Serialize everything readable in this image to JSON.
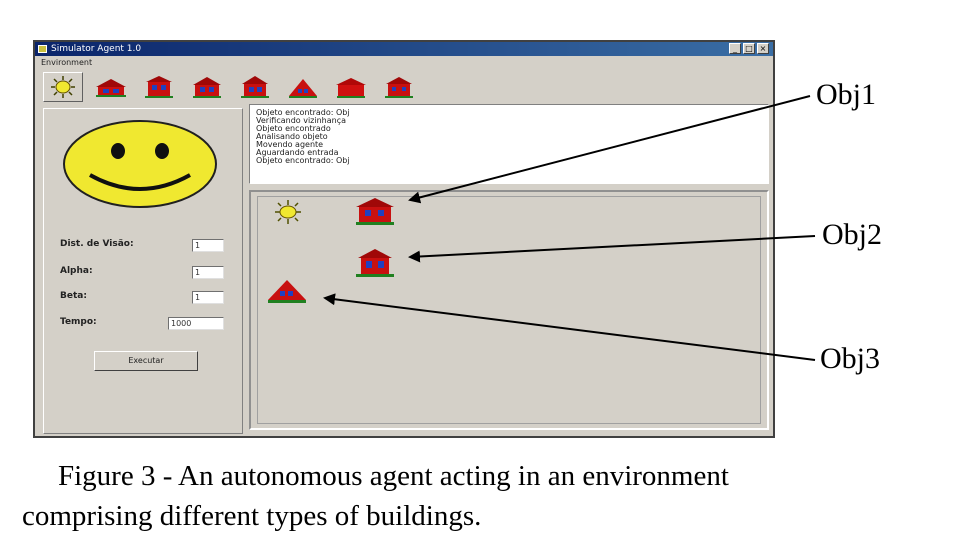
{
  "window": {
    "title": "Simulator Agent 1.0",
    "menu": "Environment",
    "buttons": [
      "_",
      "□",
      "×"
    ]
  },
  "toolbar": {
    "items": [
      {
        "name": "agent",
        "icon": "sun-agent-icon"
      },
      {
        "name": "building1",
        "icon": "building-icon"
      },
      {
        "name": "building2",
        "icon": "building-icon"
      },
      {
        "name": "building3",
        "icon": "building-icon"
      },
      {
        "name": "building4",
        "icon": "building-icon"
      },
      {
        "name": "building5",
        "icon": "building-icon"
      },
      {
        "name": "building6",
        "icon": "building-icon"
      },
      {
        "name": "building7",
        "icon": "building-icon"
      }
    ]
  },
  "params": {
    "vision_label": "Dist. de Visão:",
    "vision_value": "1",
    "alpha_label": "Alpha:",
    "alpha_value": "1",
    "beta_label": "Beta:",
    "beta_value": "1",
    "time_label": "Tempo:",
    "time_value": "1000",
    "execute_label": "Executar"
  },
  "log": {
    "lines": [
      "Objeto encontrado: Obj",
      "Verificando vizinhança",
      "Objeto encontrado",
      "Analisando objeto",
      "Movendo agente",
      "Aguardando entrada",
      "Objeto encontrado: Obj"
    ]
  },
  "callouts": {
    "obj1": "Obj1",
    "obj2": "Obj2",
    "obj3": "Obj3"
  },
  "caption": {
    "line1": "Figure 3 - An autonomous agent acting in an environment",
    "line2": "comprising different types of buildings."
  },
  "colors": {
    "window_bg": "#d4d0c8",
    "smiley": "#f0e830",
    "building_roof": "#c81010",
    "building_window": "#2040c0"
  }
}
